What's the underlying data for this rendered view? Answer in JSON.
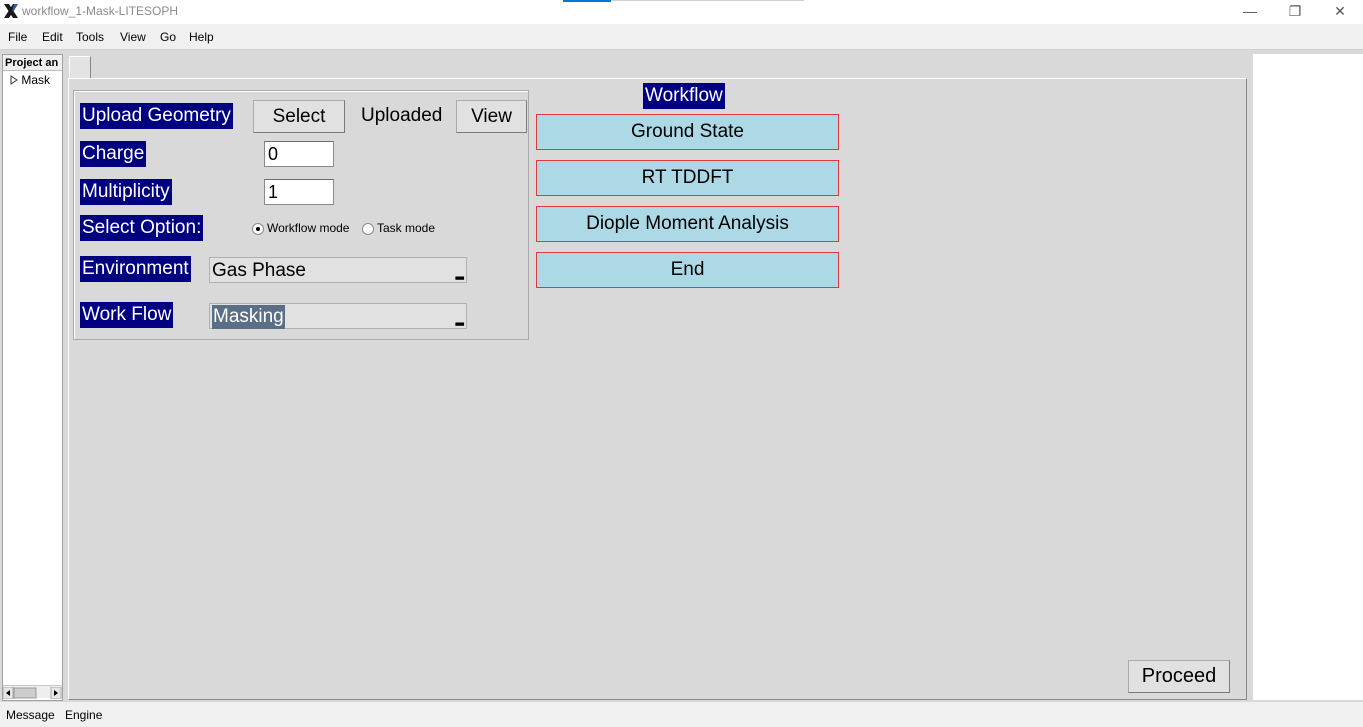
{
  "window": {
    "title": "workflow_1-Mask-LITESOPH",
    "controls": {
      "minimize": "—",
      "restore": "❐",
      "close": "✕"
    }
  },
  "menu": [
    "File",
    "Edit",
    "Tools",
    "View",
    "Go",
    "Help"
  ],
  "tree": {
    "header": "Project an",
    "items": [
      {
        "label": "Mask"
      }
    ]
  },
  "form": {
    "upload_geometry_label": "Upload Geometry",
    "select_button": "Select",
    "uploaded_text": "Uploaded",
    "view_button": "View",
    "charge_label": "Charge",
    "charge_value": "0",
    "multiplicity_label": "Multiplicity",
    "multiplicity_value": "1",
    "select_option_label": "Select Option:",
    "radio_options": [
      {
        "label": "Workflow mode",
        "selected": true
      },
      {
        "label": "Task mode",
        "selected": false
      }
    ],
    "environment_label": "Environment",
    "environment_value": "Gas Phase",
    "workflow_label": "Work Flow",
    "workflow_value": "Masking"
  },
  "workflow": {
    "title": "Workflow",
    "steps": [
      "Ground State",
      "RT TDDFT",
      "Diople Moment Analysis",
      "End"
    ]
  },
  "proceed_button": "Proceed",
  "statusbar": [
    "Message",
    "Engine"
  ],
  "colors": {
    "label_bg": "#000080",
    "workflow_button_bg": "#add8e6",
    "workflow_button_border": "#e03a3a",
    "selected_text_bg": "#5a6e85"
  }
}
